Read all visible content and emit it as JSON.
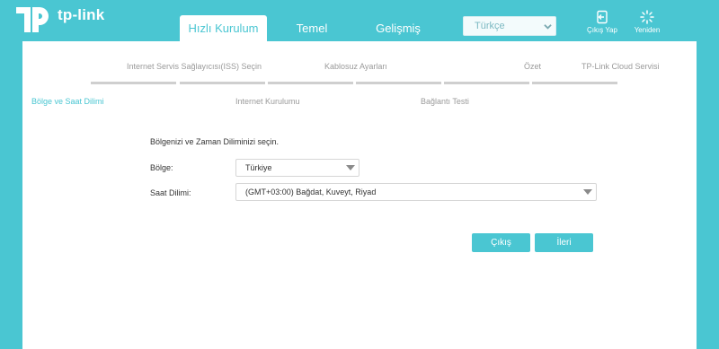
{
  "brand": {
    "name": "tp-link"
  },
  "nav": {
    "tabs": [
      {
        "label": "Hızlı Kurulum",
        "active": true
      },
      {
        "label": "Temel"
      },
      {
        "label": "Gelişmiş"
      }
    ],
    "language": {
      "selected": "Türkçe"
    },
    "logout_label": "Çıkış Yap",
    "reboot_label": "Yeniden"
  },
  "wizard": {
    "steps": [
      {
        "label": "Internet Servis Sağlayıcısı(ISS) Seçin"
      },
      {
        "label": "Kablosuz Ayarları"
      },
      {
        "label": "Özet"
      },
      {
        "label": "TP-Link Cloud Servisi"
      }
    ],
    "substeps": [
      {
        "label": "Bölge ve Saat Dilimi",
        "active": true
      },
      {
        "label": "Internet Kurulumu"
      },
      {
        "label": "Bağlantı Testi"
      }
    ]
  },
  "form": {
    "intro": "Bölgenizi ve Zaman Diliminizi seçin.",
    "region": {
      "label": "Bölge:",
      "value": "Türkiye"
    },
    "timezone": {
      "label": "Saat Dilimi:",
      "value": "(GMT+03:00) Bağdat, Kuveyt, Riyad"
    }
  },
  "buttons": {
    "exit": "Çıkış",
    "next": "İleri"
  },
  "colors": {
    "accent": "#4ac6d2",
    "panel": "#ffffff",
    "step_bar": "#cfcfcf"
  },
  "icons": [
    "tp-link-logo-icon",
    "logout-icon",
    "reboot-icon",
    "chevron-down-icon",
    "dropdown-arrow-icon"
  ]
}
